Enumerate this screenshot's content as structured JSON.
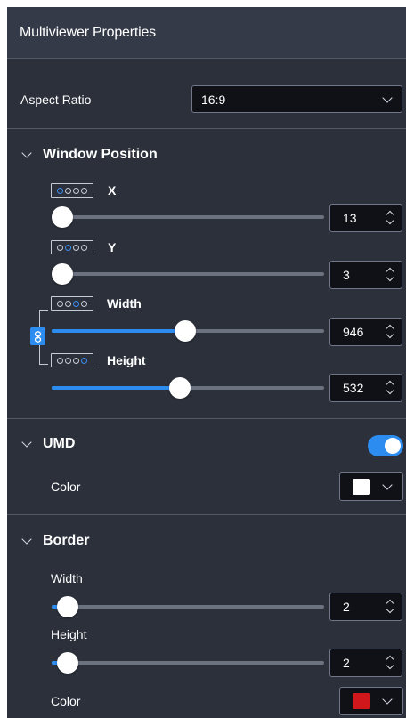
{
  "panel": {
    "title": "Multiviewer Properties"
  },
  "aspect_ratio": {
    "label": "Aspect Ratio",
    "value": "16:9"
  },
  "window_position": {
    "title": "Window Position",
    "x": {
      "label": "X",
      "value": "13",
      "slider_fraction": 0.02
    },
    "y": {
      "label": "Y",
      "value": "3",
      "slider_fraction": 0.0
    },
    "width": {
      "label": "Width",
      "value": "946",
      "slider_fraction": 0.49
    },
    "height": {
      "label": "Height",
      "value": "532",
      "slider_fraction": 0.47
    }
  },
  "umd": {
    "title": "UMD",
    "enabled": true,
    "color_label": "Color",
    "color": "#ffffff"
  },
  "border": {
    "title": "Border",
    "width": {
      "label": "Width",
      "value": "2",
      "slider_fraction": 0.06
    },
    "height": {
      "label": "Height",
      "value": "2",
      "slider_fraction": 0.06
    },
    "color_label": "Color",
    "color": "#d0181c"
  },
  "colors": {
    "accent": "#2d8cf0",
    "panel_bg": "#2b303b",
    "header_bg": "#343a47",
    "input_bg": "#0f1116"
  }
}
